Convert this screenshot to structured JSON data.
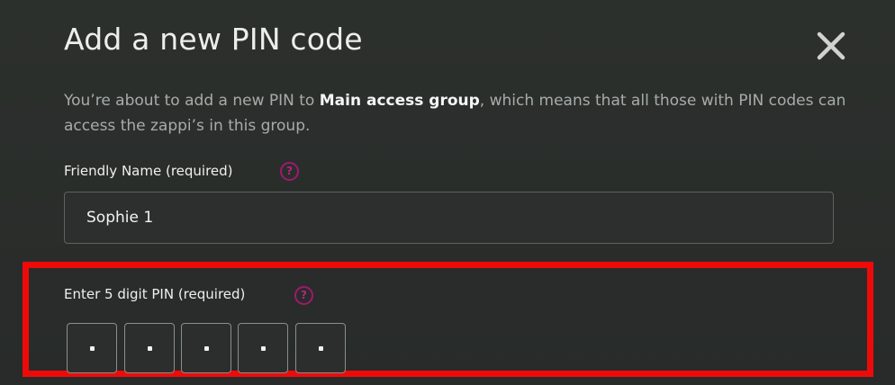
{
  "modal": {
    "title": "Add a new PIN code",
    "close_icon": "close-icon"
  },
  "description": {
    "text_before": "You’re about to add a new PIN to ",
    "group_name": "Main access group",
    "text_after": ", which means that all those with PIN codes can access the zappi’s in this group."
  },
  "friendly_name": {
    "label": "Friendly Name (required)",
    "help_icon": "?",
    "value": "Sophie 1"
  },
  "pin": {
    "label": "Enter 5 digit PIN (required)",
    "help_icon": "?",
    "digits": [
      "•",
      "•",
      "•",
      "•",
      "•"
    ]
  },
  "colors": {
    "accent": "#b8237f",
    "highlight": "#ef0a0a",
    "background": "#2a2d2b"
  }
}
